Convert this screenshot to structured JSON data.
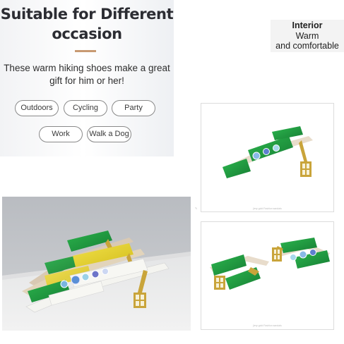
{
  "promo": {
    "title_line1": "Suitable for Different",
    "title_line2": "occasion",
    "subtitle_line1": "These warm hiking shoes make a great",
    "subtitle_line2": "gift for him or her!",
    "tags": [
      "Outdoors",
      "Cycling",
      "Party",
      "Work",
      "Walk a Dog"
    ]
  },
  "interior": {
    "label": "Interior",
    "line2": "Warm",
    "line3": "and comfortable"
  },
  "product_photos": {
    "caption": "jiery gold Fashion sandals",
    "icons": [
      "sandal-photo-icon",
      "sandal-photo-icon",
      "sandal-photo-icon"
    ]
  },
  "colors": {
    "green_strap": "#1f9b3e",
    "yellow_strap": "#e6d02a",
    "white_strap": "#f4f4f0",
    "gold_heel": "#c9a43a",
    "accent_divider": "#c89a72"
  }
}
